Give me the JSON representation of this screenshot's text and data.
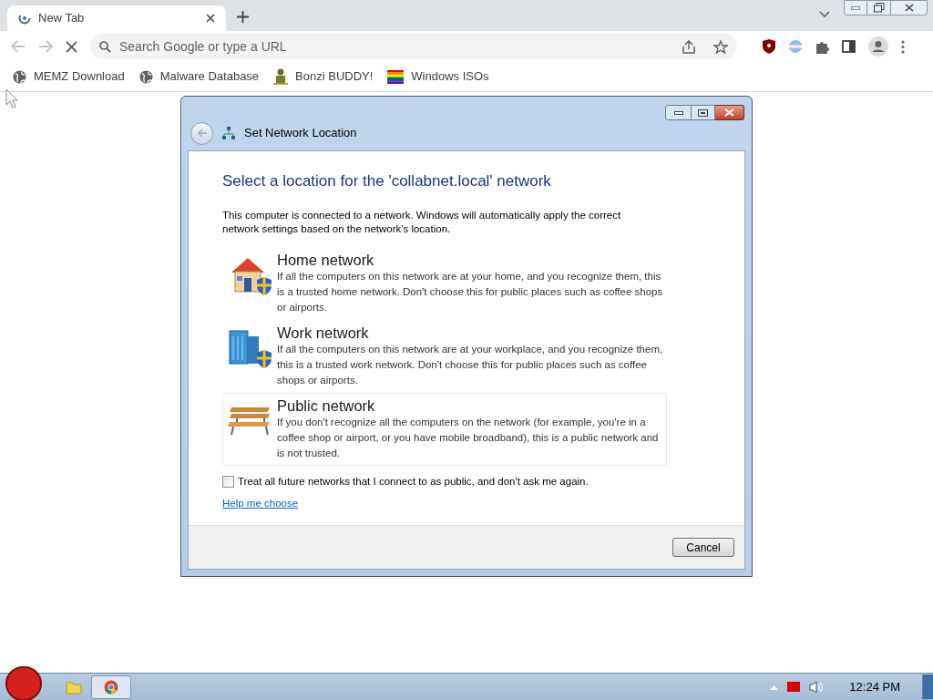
{
  "browser": {
    "tabs": [
      {
        "title": "New Tab",
        "selected": true
      }
    ],
    "address_bar": {
      "placeholder": "Search Google or type a URL"
    },
    "bookmarks": [
      {
        "label": "MEMZ Download",
        "kind": "globe"
      },
      {
        "label": "Malware Database",
        "kind": "globe"
      },
      {
        "label": "Bonzi BUDDY!",
        "kind": "figure"
      },
      {
        "label": "Windows ISOs",
        "kind": "rainbow"
      }
    ]
  },
  "dialog": {
    "title": "Set Network Location",
    "heading": "Select a location for the 'collabnet.local' network",
    "intro": "This computer is connected to a network. Windows will automatically apply the correct network settings based on the network's location.",
    "options": [
      {
        "kind": "home",
        "title": "Home network",
        "description": "If all the computers on this network are at your home, and you recognize them, this is a trusted home network.  Don't choose this for public places such as coffee shops or airports.",
        "highlighted": false
      },
      {
        "kind": "work",
        "title": "Work network",
        "description": "If all the computers on this network are at your workplace, and you recognize them, this is a trusted work network.  Don't choose this for public places such as coffee shops or airports.",
        "highlighted": false
      },
      {
        "kind": "public",
        "title": "Public network",
        "description": "If you don't recognize all the computers on the network (for example, you're in a coffee shop or airport, or you have mobile broadband), this is a public network and is not trusted.",
        "highlighted": true
      }
    ],
    "checkbox": {
      "label": "Treat all future networks that I connect to as public, and don't ask me again.",
      "checked": false
    },
    "help_link": "Help me choose",
    "cancel_button": "Cancel"
  },
  "taskbar": {
    "clock": "12:24 PM"
  }
}
